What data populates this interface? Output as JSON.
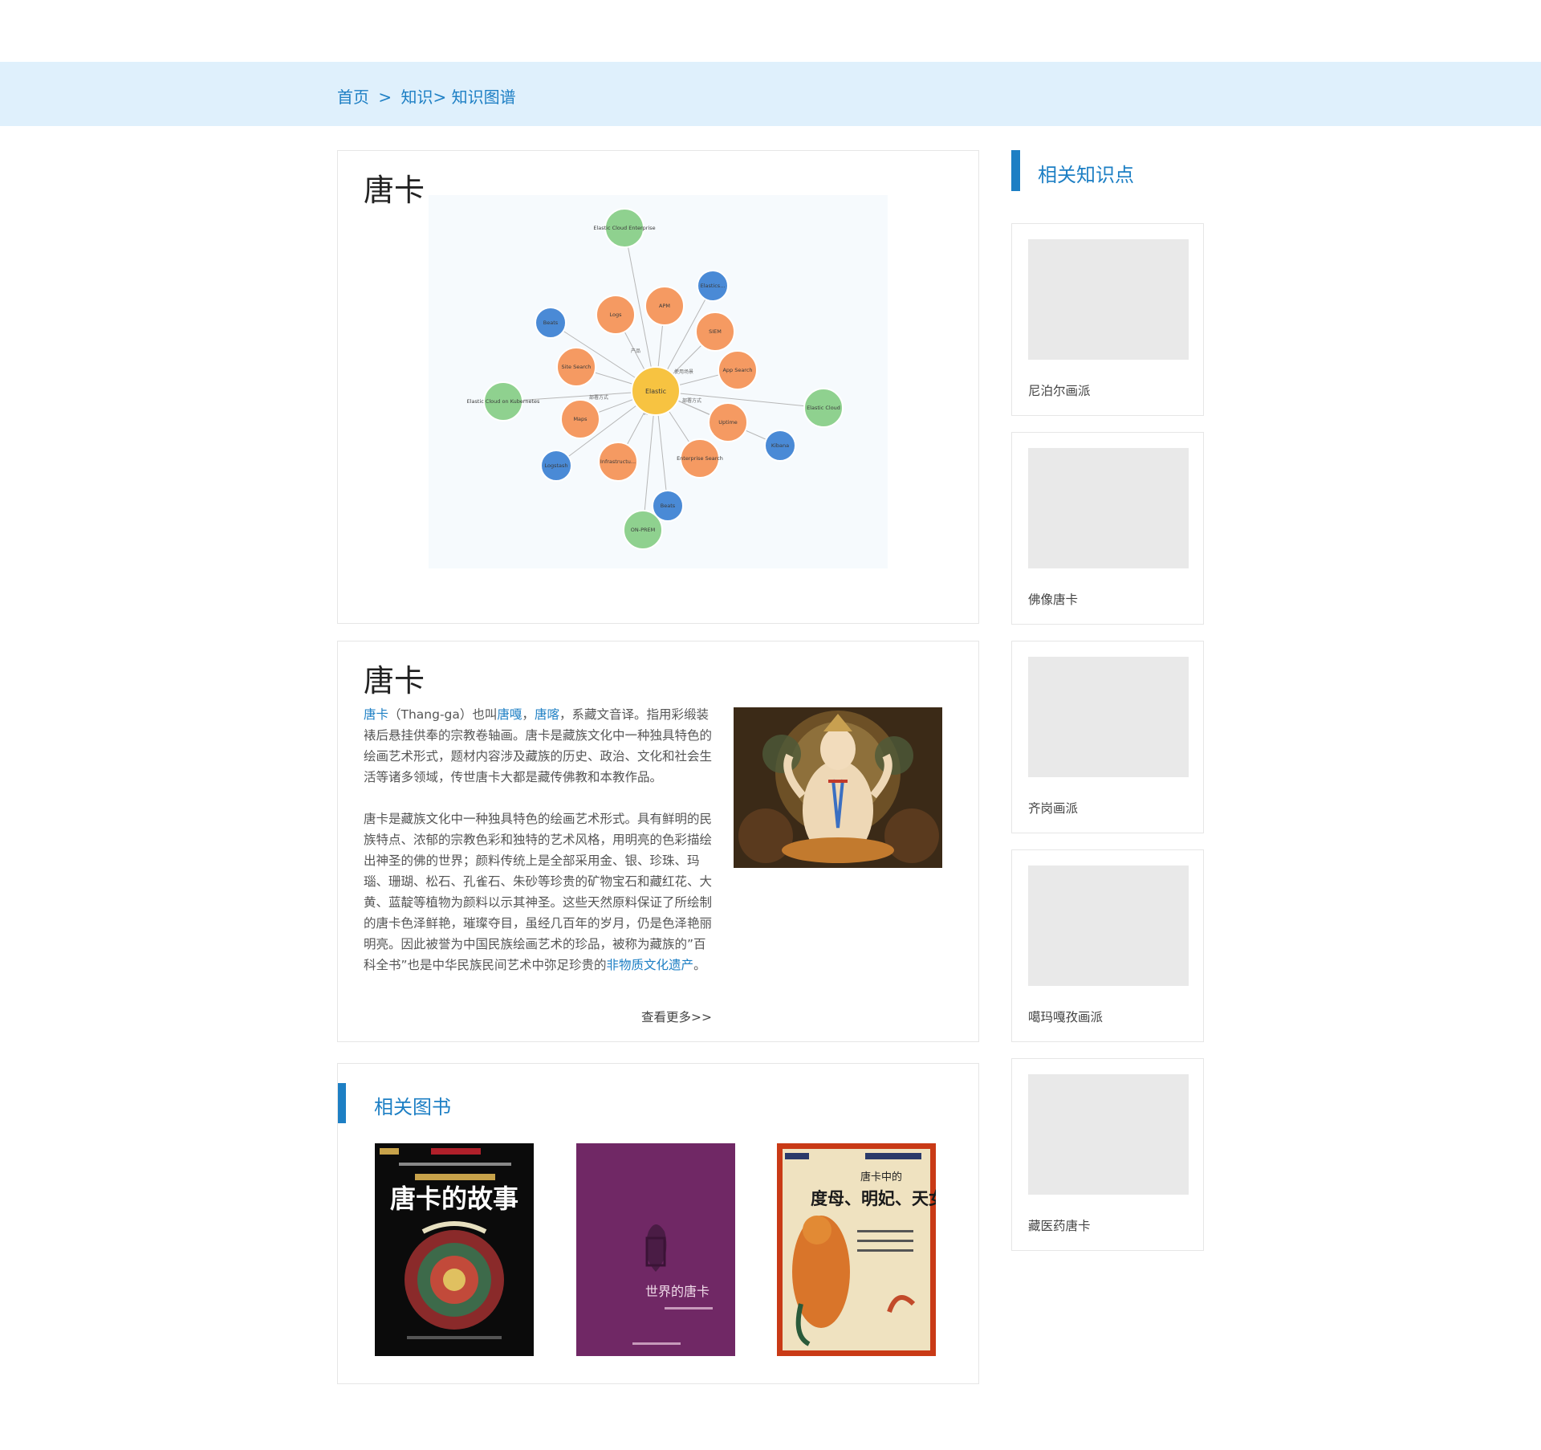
{
  "breadcrumb": {
    "home": "首页",
    "separator": ">",
    "knowledge": "知识>",
    "current": "知识图谱"
  },
  "graph_card": {
    "title": "唐卡",
    "center": "Elastic",
    "nodes": [
      {
        "label": "Elastic Cloud Enterprise",
        "kind": "green"
      },
      {
        "label": "Elastic Cloud on Kubernetes",
        "kind": "green"
      },
      {
        "label": "Elastic Cloud",
        "kind": "green"
      },
      {
        "label": "ON-PREM",
        "kind": "green"
      },
      {
        "label": "Logs",
        "kind": "orange"
      },
      {
        "label": "APM",
        "kind": "orange"
      },
      {
        "label": "SIEM",
        "kind": "orange"
      },
      {
        "label": "Site Search",
        "kind": "orange"
      },
      {
        "label": "App Search",
        "kind": "orange"
      },
      {
        "label": "Maps",
        "kind": "orange"
      },
      {
        "label": "Uptime",
        "kind": "orange"
      },
      {
        "label": "Infrastructu...",
        "kind": "orange"
      },
      {
        "label": "Enterprise Search",
        "kind": "orange"
      },
      {
        "label": "Elastics...",
        "kind": "blue"
      },
      {
        "label": "Beats",
        "kind": "blue"
      },
      {
        "label": "Logstash",
        "kind": "blue"
      },
      {
        "label": "Kibana",
        "kind": "blue"
      },
      {
        "label": "Beats",
        "kind": "blue"
      }
    ],
    "edges": [
      "部署方式",
      "使用场景",
      "产品",
      "部署方式",
      "使用场景"
    ],
    "colors": {
      "green": "#8fd18f",
      "orange": "#f59a62",
      "blue": "#4a8ad6",
      "center": "#f7c341"
    }
  },
  "intro": {
    "title": "唐卡",
    "link_tangka": "唐卡",
    "p1_a": "（Thang-ga）也叫",
    "link_tanggu": "唐嘎",
    "comma": "，",
    "link_tangka2": "唐喀",
    "p1_b": "，系藏文音译。指用彩缎装裱后悬挂供奉的宗教卷轴画。唐卡是藏族文化中一种独具特色的绘画艺术形式，题材内容涉及藏族的历史、政治、文化和社会生活等诸多领域，传世唐卡大都是藏传佛教和本教作品。",
    "p2": "唐卡是藏族文化中一种独具特色的绘画艺术形式。具有鲜明的民族特点、浓郁的宗教色彩和独特的艺术风格，用明亮的色彩描绘出神圣的佛的世界；颜料传统上是全部采用金、银、珍珠、玛瑙、珊瑚、松石、孔雀石、朱砂等珍贵的矿物宝石和藏红花、大黄、蓝靛等植物为颜料以示其神圣。这些天然原料保证了所绘制的唐卡色泽鲜艳，璀璨夺目，虽经几百年的岁月，仍是色泽艳丽明亮。因此被誉为中国民族绘画艺术的珍品，被称为藏族的”百科全书”也是中华民族民间艺术中弥足珍贵的",
    "link_heritage": "非物质文化遗产",
    "period": "。",
    "more": "查看更多>>"
  },
  "books": {
    "heading": "相关图书",
    "items": [
      {
        "title": "唐卡的故事",
        "cover_bg": "#0b0b0b"
      },
      {
        "title": "世界的唐卡",
        "cover_bg": "#7a2d6d"
      },
      {
        "title": "唐卡中的",
        "subtitle": "度母、明妃、天女",
        "cover_bg": "#c93a16"
      }
    ]
  },
  "sidebar": {
    "heading": "相关知识点",
    "items": [
      {
        "name": "尼泊尔画派"
      },
      {
        "name": "佛像唐卡"
      },
      {
        "name": "齐岗画派"
      },
      {
        "name": "噶玛嘎孜画派"
      },
      {
        "name": "藏医药唐卡"
      }
    ]
  }
}
